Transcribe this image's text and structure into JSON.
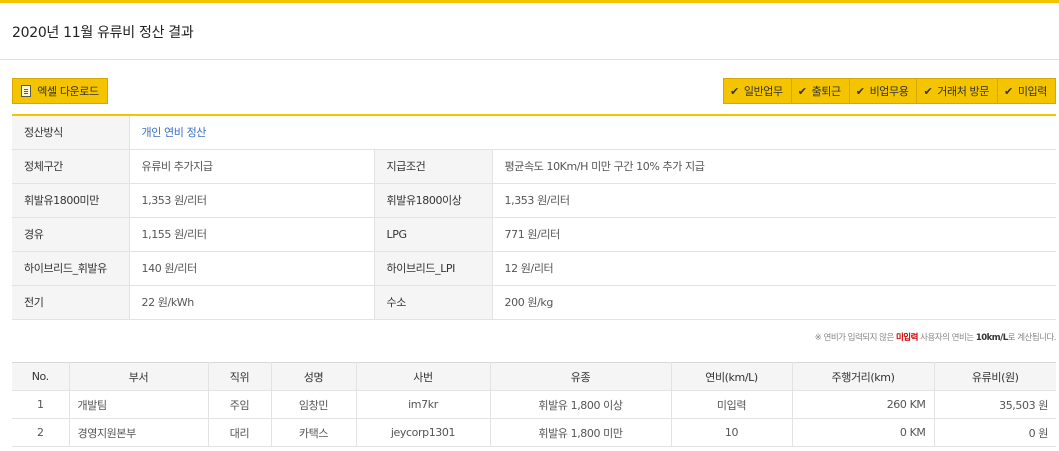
{
  "page": {
    "title": "2020년 11월 유류비 정산 결과"
  },
  "toolbar": {
    "excel_label": "엑셀 다운로드",
    "filters": [
      "일반업무",
      "출퇴근",
      "비업무용",
      "거래처 방문",
      "미입력"
    ]
  },
  "settings": {
    "method_label": "정산방식",
    "method_value": "개인 연비 정산",
    "congestion_label": "정체구간",
    "congestion_value": "유류비 추가지급",
    "condition_label": "지급조건",
    "condition_value": "평균속도 10Km/H 미만 구간 10% 추가 지급",
    "gas_under_label": "휘발유1800미만",
    "gas_under_value": "1,353 원/리터",
    "gas_over_label": "휘발유1800이상",
    "gas_over_value": "1,353 원/리터",
    "diesel_label": "경유",
    "diesel_value": "1,155 원/리터",
    "lpg_label": "LPG",
    "lpg_value": "771 원/리터",
    "hybrid_gas_label": "하이브리드_휘발유",
    "hybrid_gas_value": "140 원/리터",
    "hybrid_lpi_label": "하이브리드_LPI",
    "hybrid_lpi_value": "12 원/리터",
    "electric_label": "전기",
    "electric_value": "22 원/kWh",
    "hydrogen_label": "수소",
    "hydrogen_value": "200 원/kg"
  },
  "note": {
    "prefix": "※ 연비가 입력되지 않은",
    "highlight": "미입력",
    "middle": "사용자의 연비는",
    "bold": "10km/L",
    "suffix": "로 계산됩니다."
  },
  "table": {
    "headers": [
      "No.",
      "부서",
      "직위",
      "성명",
      "사번",
      "유종",
      "연비(km/L)",
      "주행거리(km)",
      "유류비(원)"
    ],
    "rows": [
      {
        "no": "1",
        "dept": "개발팀",
        "position": "주임",
        "name": "임창민",
        "emp_id": "im7kr",
        "fuel": "휘발유 1,800 이상",
        "efficiency": "미입력",
        "distance": "260 KM",
        "cost": "35,503 원"
      },
      {
        "no": "2",
        "dept": "경영지원본부",
        "position": "대리",
        "name": "카택스",
        "emp_id": "jeycorp1301",
        "fuel": "휘발유 1,800 미만",
        "efficiency": "10",
        "distance": "0 KM",
        "cost": "0 원"
      }
    ]
  },
  "colors": {
    "accent": "#f5c400",
    "link": "#3a6fc4",
    "warning": "#cc0000"
  }
}
